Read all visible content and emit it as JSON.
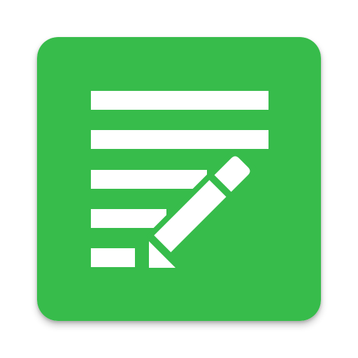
{
  "icon": {
    "name": "notes-edit-app-icon",
    "depicts": [
      "lined-note-icon",
      "pencil-icon"
    ]
  },
  "colors": {
    "background": "#ffffff",
    "tile": "#37bc4b",
    "glyph": "#ffffff"
  }
}
